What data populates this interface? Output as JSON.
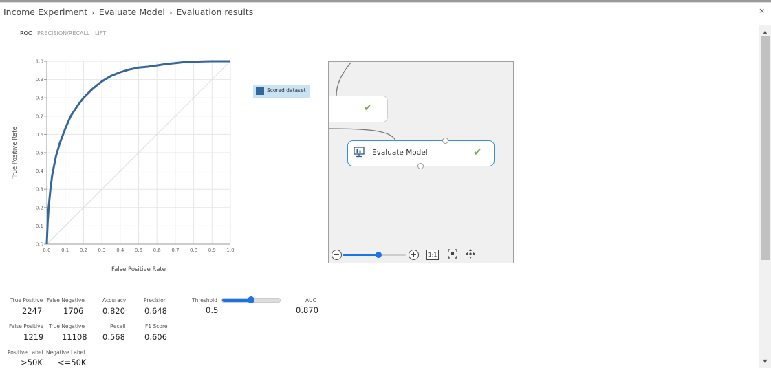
{
  "breadcrumb": {
    "items": [
      "Income Experiment",
      "Evaluate Model",
      "Evaluation results"
    ],
    "separator": "›"
  },
  "window": {
    "close_label": "×"
  },
  "tabs": [
    {
      "label": "ROC",
      "active": true
    },
    {
      "label": "PRECISION/RECALL",
      "active": false
    },
    {
      "label": "LIFT",
      "active": false
    }
  ],
  "chart_data": {
    "type": "line",
    "xlabel": "False Positive Rate",
    "ylabel": "True Positive Rate",
    "xlim": [
      0,
      1
    ],
    "ylim": [
      0,
      1
    ],
    "x_ticks": [
      "0.0",
      "0.1",
      "0.2",
      "0.3",
      "0.4",
      "0.5",
      "0.6",
      "0.7",
      "0.8",
      "0.9",
      "1.0"
    ],
    "y_ticks": [
      "0.0",
      "0.1",
      "0.2",
      "0.3",
      "0.4",
      "0.5",
      "0.6",
      "0.7",
      "0.8",
      "0.9",
      "1.0"
    ],
    "grid": true,
    "legend_placement": "right",
    "series": [
      {
        "name": "Scored dataset",
        "color": "#336699",
        "x": [
          0,
          0.005,
          0.01,
          0.02,
          0.03,
          0.05,
          0.07,
          0.1,
          0.13,
          0.17,
          0.2,
          0.25,
          0.3,
          0.35,
          0.4,
          0.45,
          0.5,
          0.55,
          0.6,
          0.65,
          0.7,
          0.75,
          0.8,
          0.85,
          0.9,
          1.0
        ],
        "y": [
          0,
          0.12,
          0.2,
          0.3,
          0.38,
          0.48,
          0.55,
          0.63,
          0.7,
          0.76,
          0.8,
          0.85,
          0.89,
          0.92,
          0.94,
          0.955,
          0.965,
          0.97,
          0.977,
          0.985,
          0.99,
          0.995,
          0.997,
          0.999,
          1.0,
          1.0
        ]
      },
      {
        "name": "",
        "color": "#dddddd",
        "x": [
          0,
          1
        ],
        "y": [
          0,
          1
        ]
      }
    ]
  },
  "legend": {
    "label": "Scored dataset",
    "color": "#336699"
  },
  "canvas": {
    "module_label": "Evaluate Model",
    "zoom_level": 0.57,
    "zoom_minus": "−",
    "zoom_plus": "+",
    "actual_size_label": "1:1",
    "fit_icon": "fit-to-screen-icon",
    "pan_icon": "pan-icon"
  },
  "metrics": {
    "true_positive_label": "True Positive",
    "true_positive": "2247",
    "false_negative_label": "False Negative",
    "false_negative": "1706",
    "accuracy_label": "Accuracy",
    "accuracy": "0.820",
    "precision_label": "Precision",
    "precision": "0.648",
    "threshold_label": "Threshold",
    "threshold": "0.5",
    "threshold_fill": 0.5,
    "auc_label": "AUC",
    "auc": "0.870",
    "false_positive_label": "False Positive",
    "false_positive": "1219",
    "true_negative_label": "True Negative",
    "true_negative": "11108",
    "recall_label": "Recall",
    "recall": "0.568",
    "f1_label": "F1 Score",
    "f1": "0.606",
    "positive_label_label": "Positive Label",
    "positive_label": ">50K",
    "negative_label_label": "Negative Label",
    "negative_label": "<=50K"
  },
  "colors": {
    "accent": "#1a73e8",
    "check": "#6cb33e",
    "module_border": "#3b8ed0"
  }
}
